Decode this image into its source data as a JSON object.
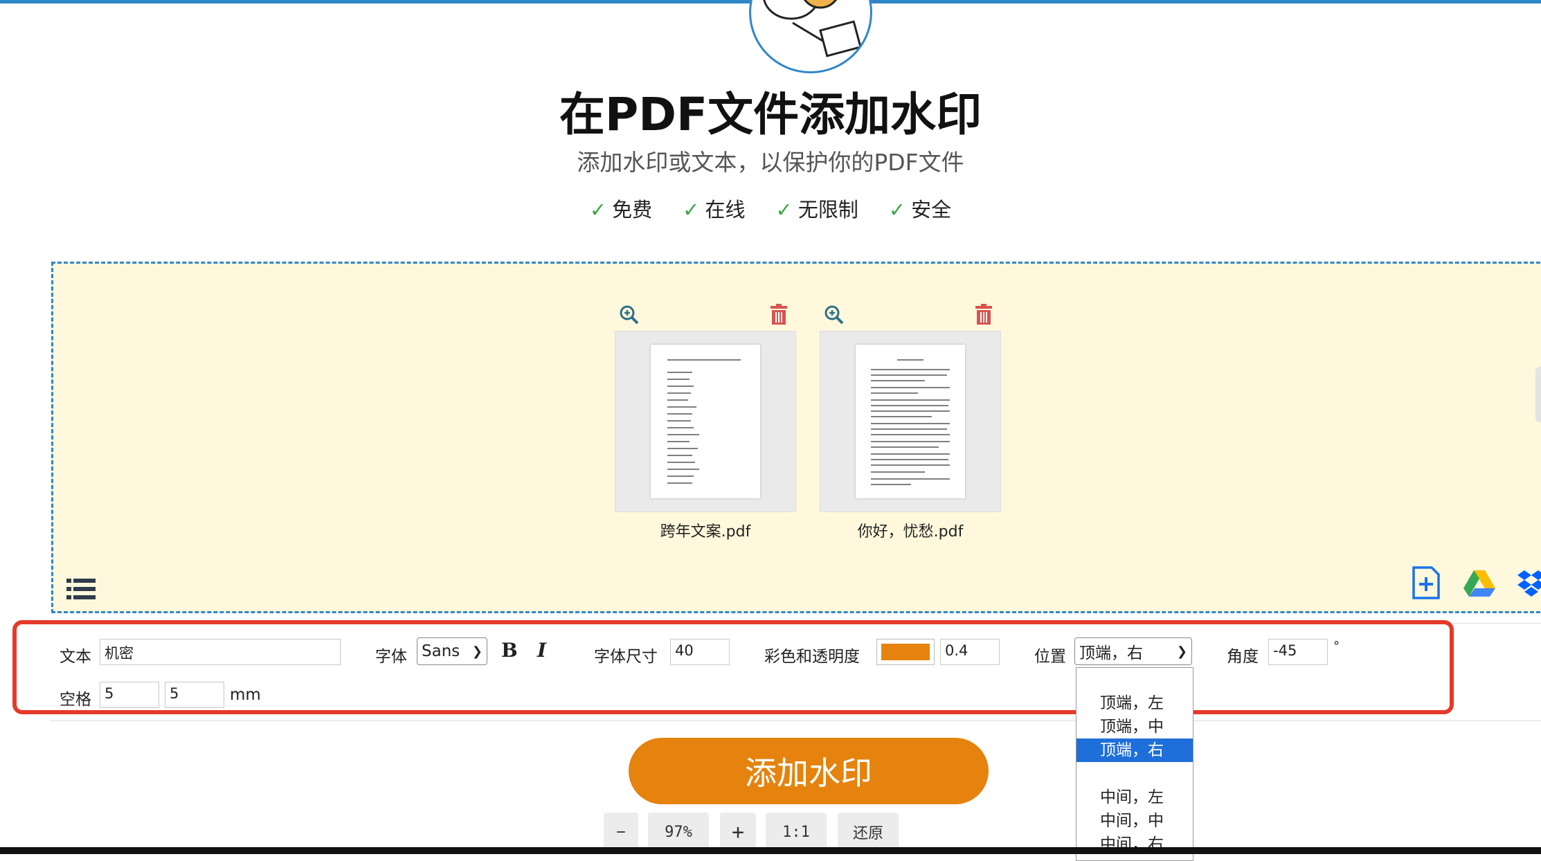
{
  "header": {
    "title": "在PDF文件添加水印",
    "subtitle": "添加水印或文本，以保护你的PDF文件",
    "check_mark": "✓",
    "features": [
      "免费",
      "在线",
      "无限制",
      "安全"
    ]
  },
  "files": [
    {
      "name": "跨年文案.pdf"
    },
    {
      "name": "你好，忧愁.pdf"
    }
  ],
  "toolbar": {
    "text_label": "文本",
    "text_value": "机密",
    "font_label": "字体",
    "font_value": "Sans",
    "bold_label": "B",
    "italic_label": "I",
    "size_label": "字体尺寸",
    "size_value": "40",
    "color_label": "彩色和透明度",
    "color_value": "#e5830e",
    "opacity_value": "0.4",
    "position_label": "位置",
    "position_value": "顶端，右",
    "angle_label": "角度",
    "angle_value": "-45",
    "angle_unit": "°",
    "spacing_label": "空格",
    "spacing_x": "5",
    "spacing_y": "5",
    "spacing_unit": "mm"
  },
  "position_options": [
    "顶端，左",
    "顶端，中",
    "顶端，右",
    "中间，左",
    "中间，中",
    "中间，右"
  ],
  "selected_position_index": 2,
  "cta_label": "添加水印",
  "zoom_bar": {
    "minus": "−",
    "zoom": "97%",
    "plus": "+",
    "one_to_one": "1:1",
    "reset": "还原"
  },
  "colors": {
    "accent": "#e5830e",
    "brand_blue": "#2f86c8",
    "highlight_red": "#e53a2a",
    "dropzone_bg": "#fff8dc",
    "selected_option": "#1e6fd9"
  },
  "icons": [
    "mascot-image",
    "zoom-in-icon",
    "trash-icon",
    "list-icon",
    "add-file-icon",
    "google-drive-icon",
    "dropbox-icon",
    "chevron-down-icon"
  ]
}
